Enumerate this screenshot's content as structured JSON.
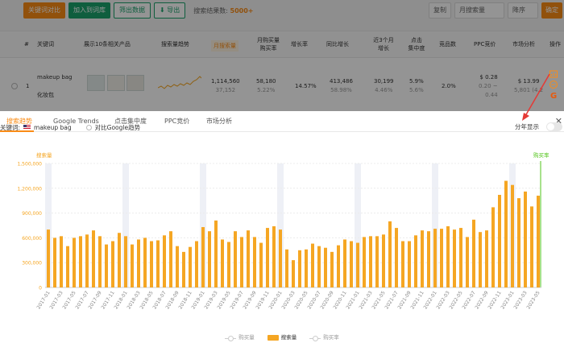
{
  "toolbar": {
    "buttons": [
      "关键词对比",
      "加入到词库",
      "筛出数据",
      "导出"
    ],
    "count_label": "搜索结果数:",
    "count_value": "5000+",
    "right_items": [
      "复制",
      "月搜索量",
      "降序",
      "确定"
    ]
  },
  "table": {
    "headers": [
      "#",
      "关键词",
      "展示10条相关产品",
      "搜索量趋势",
      "月搜索量",
      "月购买量 购买率",
      "增长率",
      "同比增长",
      "近3个月 增长",
      "点击 集中度",
      "竞品数",
      "PPC竞价",
      "市场分析",
      "操作"
    ],
    "row": {
      "index": "1",
      "keyword": "makeup bag",
      "keyword_sub": "化妆包",
      "monthly_search": "1,114,560",
      "monthly_search_sub": "37,152",
      "purchases": "58,180",
      "purchase_rate": "5.22%",
      "growth": "14.57%",
      "yoy": "413,486",
      "yoy_rate": "58.98%",
      "three_month": "30,199",
      "three_month_rate": "4.46%",
      "click_conc": "5.9%",
      "click_conc_sub": "5.6%",
      "competitors": "2.0%",
      "ppc": "$ 0.28",
      "ppc_range": "0.20 ~",
      "ppc_range2": "0.44",
      "market_price": "$ 13.99",
      "market_sub": "5,801 (4.2"
    }
  },
  "tabs": [
    "搜索趋势",
    "Google Trends",
    "点击集中度",
    "PPC竞价",
    "市场分析"
  ],
  "active_tab": 0,
  "keyword_line": {
    "label": "关键词:",
    "keyword": "makeup bag",
    "compare_label": "对比Google趋势",
    "year_label": "分年显示"
  },
  "chart_data": {
    "type": "bar",
    "y_axis_label": "搜索量",
    "y2_axis_label": "购买率",
    "ylim": [
      0,
      1500000
    ],
    "yticks": [
      "0",
      "300,000",
      "600,000",
      "900,000",
      "1,200,000",
      "1,500,000"
    ],
    "x_tick_labels": [
      "2017-01",
      "2017-03",
      "2017-05",
      "2017-07",
      "2017-09",
      "2017-11",
      "2018-01",
      "2018-03",
      "2018-05",
      "2018-07",
      "2018-09",
      "2018-11",
      "2019-01",
      "2019-03",
      "2019-05",
      "2019-07",
      "2019-09",
      "2019-11",
      "2020-01",
      "2020-03",
      "2020-05",
      "2020-07",
      "2020-09",
      "2020-11",
      "2021-01",
      "2021-03",
      "2021-05",
      "2021-07",
      "2021-09",
      "2021-11",
      "2022-01",
      "2022-03",
      "2022-05",
      "2022-07",
      "2022-09",
      "2022-11",
      "2023-01",
      "2023-03",
      "2023-05"
    ],
    "series": [
      {
        "name": "搜索量",
        "color": "#f5a623",
        "values": [
          700000,
          600000,
          620000,
          500000,
          600000,
          620000,
          640000,
          690000,
          620000,
          520000,
          560000,
          660000,
          620000,
          520000,
          580000,
          600000,
          560000,
          570000,
          630000,
          680000,
          500000,
          430000,
          490000,
          560000,
          730000,
          680000,
          810000,
          580000,
          550000,
          680000,
          610000,
          690000,
          610000,
          540000,
          720000,
          740000,
          700000,
          460000,
          330000,
          450000,
          460000,
          530000,
          500000,
          480000,
          430000,
          510000,
          580000,
          560000,
          540000,
          610000,
          620000,
          620000,
          640000,
          800000,
          720000,
          560000,
          560000,
          630000,
          690000,
          680000,
          710000,
          710000,
          740000,
          700000,
          720000,
          610000,
          820000,
          670000,
          690000,
          970000,
          1120000,
          1290000,
          1240000,
          1080000,
          1160000,
          980000,
          1110000
        ]
      }
    ],
    "legend": [
      "购买量",
      "搜索量",
      "购买率"
    ],
    "shaded_months": [
      "2017-01",
      "2018-01",
      "2019-01",
      "2020-01",
      "2021-01",
      "2022-01",
      "2023-01"
    ]
  }
}
